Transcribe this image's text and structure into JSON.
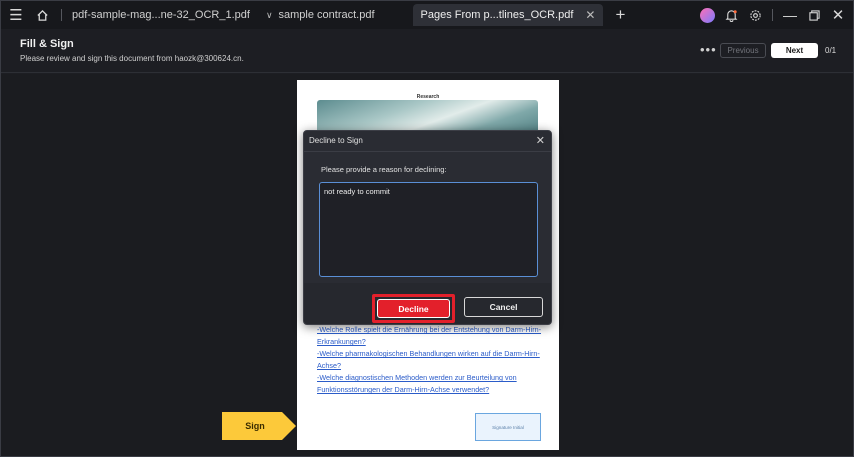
{
  "titlebar": {
    "tabs": [
      {
        "label": "pdf-sample-mag...ne-32_OCR_1.pdf"
      },
      {
        "label": "sample contract.pdf"
      },
      {
        "label": "Pages From p...tlines_OCR.pdf"
      }
    ]
  },
  "header": {
    "title": "Fill & Sign",
    "subtitle": "Please review and sign this document from haozk@300624.cn.",
    "previous_label": "Previous",
    "next_label": "Next",
    "page_count": "0/1"
  },
  "document": {
    "heading": "Research",
    "links": [
      "-Welche Rolle spielt die Ernährung bei der Entstehung von Darm-Hirn-",
      "Erkrankungen?",
      "-Welche pharmakologischen Behandlungen wirken auf die Darm-Hirn-",
      "Achse?",
      "-Welche diagnostischen Methoden werden zur Beurteilung von",
      "Funktionsstörungen der Darm-Hirn-Achse verwendet?"
    ],
    "signature_placeholder": "Signature Initial",
    "sign_label": "Sign"
  },
  "modal": {
    "title": "Decline to Sign",
    "prompt": "Please provide a reason for declining:",
    "reason_value": "not ready to commit",
    "decline_label": "Decline",
    "cancel_label": "Cancel"
  },
  "colors": {
    "accent_red": "#e3202b",
    "sign_tag": "#fcc93a",
    "link_blue": "#2b5cc9"
  }
}
